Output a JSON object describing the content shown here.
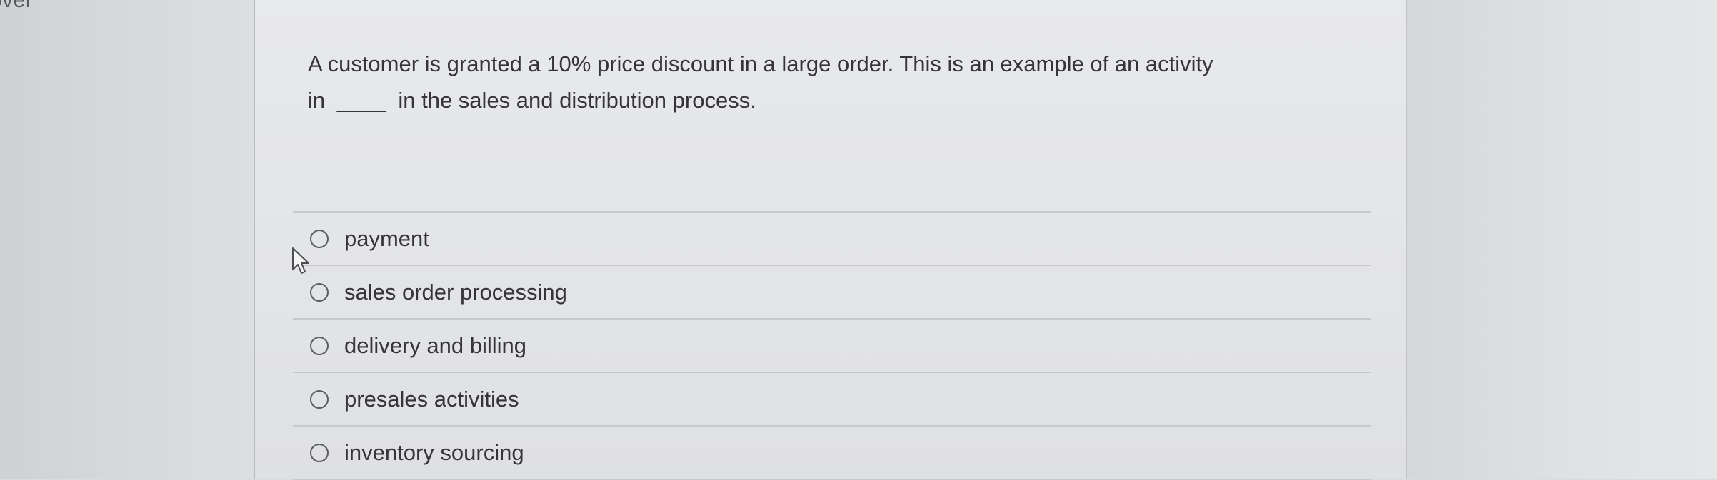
{
  "corner_label": "over",
  "question": {
    "line1": "A customer is granted a 10% price discount in a large order. This is an example of an activity",
    "line2_prefix": "in",
    "blank": "____",
    "line2_suffix": "in the sales and distribution process."
  },
  "options": [
    {
      "label": "payment",
      "selected": false
    },
    {
      "label": "sales order processing",
      "selected": false
    },
    {
      "label": "delivery and billing",
      "selected": false
    },
    {
      "label": "presales activities",
      "selected": false
    },
    {
      "label": "inventory sourcing",
      "selected": false
    }
  ],
  "icons": {
    "cursor": "mouse-pointer-icon",
    "radio": "radio-unchecked-icon"
  }
}
